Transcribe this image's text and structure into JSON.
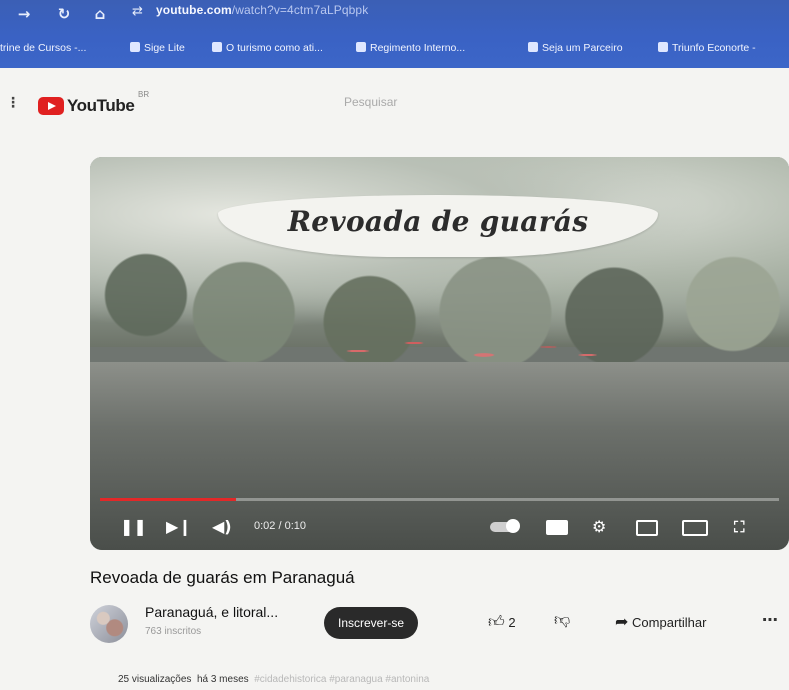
{
  "browser": {
    "url_host": "youtube.com",
    "url_path": "/watch?v=4ctm7aLPqbpk",
    "bookmarks": [
      "trine de Cursos -...",
      "Sige Lite",
      "O turismo como ati...",
      "Regimento Interno...",
      "Seja um Parceiro",
      "Triunfo Econorte -"
    ]
  },
  "header": {
    "logo_text": "YouTube",
    "country_code": "BR",
    "search_placeholder": "Pesquisar"
  },
  "player": {
    "overlay_title": "Revoada de guarás",
    "time": "0:02 / 0:10",
    "progress": 0.2
  },
  "video": {
    "title": "Revoada de guarás em Paranaguá",
    "channel_name": "Paranaguá, e litoral...",
    "subscribers": "763 inscritos",
    "subscribe_label": "Inscrever-se",
    "likes": "2",
    "share_label": "Compartilhar",
    "views": "25 visualizações",
    "age": "há 3 meses",
    "tags": "#cidadehistorica #paranagua #antonina"
  }
}
